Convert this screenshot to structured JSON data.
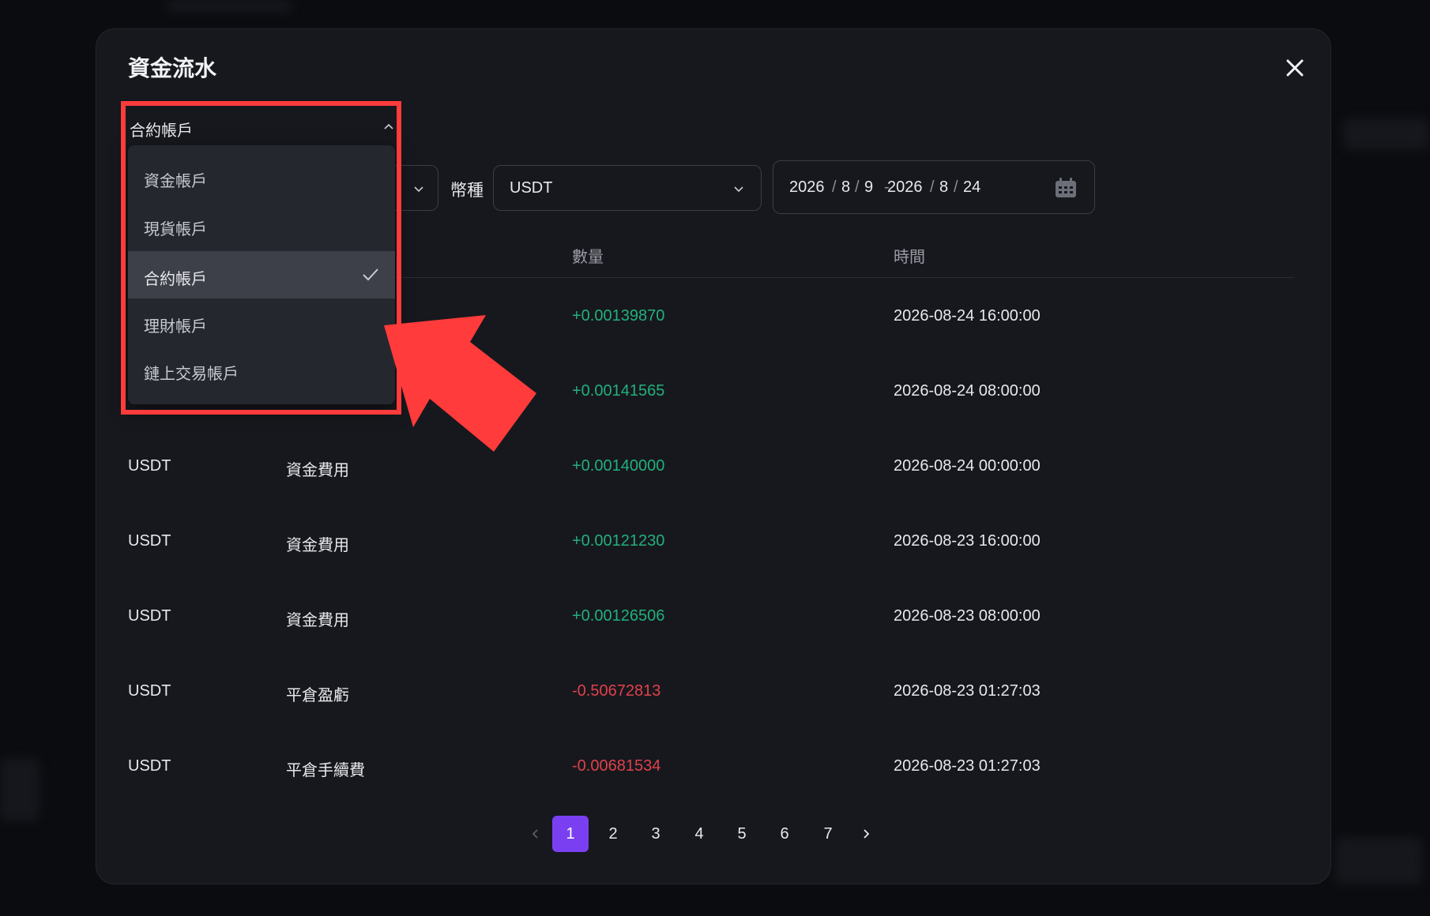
{
  "modal": {
    "title": "資金流水"
  },
  "filters": {
    "account_type": "合約帳戶",
    "currency_label": "幣種",
    "currency_value": "USDT",
    "date_start": [
      "2026",
      "8",
      "9"
    ],
    "date_end": [
      "2026",
      "8",
      "24"
    ],
    "date_separator": "-"
  },
  "dropdown": {
    "options": [
      {
        "label": "資金帳戶",
        "selected": false
      },
      {
        "label": "現貨帳戶",
        "selected": false
      },
      {
        "label": "合約帳戶",
        "selected": true
      },
      {
        "label": "理財帳戶",
        "selected": false
      },
      {
        "label": "鏈上交易帳戶",
        "selected": false
      }
    ]
  },
  "table": {
    "headers": [
      "數量",
      "時間"
    ],
    "rows": [
      {
        "coin": "",
        "type": "",
        "amount": "+0.00139870",
        "time": "2026-08-24 16:00:00",
        "sign": "pos"
      },
      {
        "coin": "",
        "type": "",
        "amount": "+0.00141565",
        "time": "2026-08-24 08:00:00",
        "sign": "pos"
      },
      {
        "coin": "USDT",
        "type": "資金費用",
        "amount": "+0.00140000",
        "time": "2026-08-24 00:00:00",
        "sign": "pos"
      },
      {
        "coin": "USDT",
        "type": "資金費用",
        "amount": "+0.00121230",
        "time": "2026-08-23 16:00:00",
        "sign": "pos"
      },
      {
        "coin": "USDT",
        "type": "資金費用",
        "amount": "+0.00126506",
        "time": "2026-08-23 08:00:00",
        "sign": "pos"
      },
      {
        "coin": "USDT",
        "type": "平倉盈虧",
        "amount": "-0.50672813",
        "time": "2026-08-23 01:27:03",
        "sign": "neg"
      },
      {
        "coin": "USDT",
        "type": "平倉手續費",
        "amount": "-0.00681534",
        "time": "2026-08-23 01:27:03",
        "sign": "neg"
      }
    ]
  },
  "pagination": {
    "pages": [
      "1",
      "2",
      "3",
      "4",
      "5",
      "6",
      "7"
    ],
    "current": "1"
  },
  "colors": {
    "positive": "#22b07d",
    "negative": "#e0414c",
    "accent": "#7b3ff2",
    "highlight": "#ff3b3b"
  }
}
